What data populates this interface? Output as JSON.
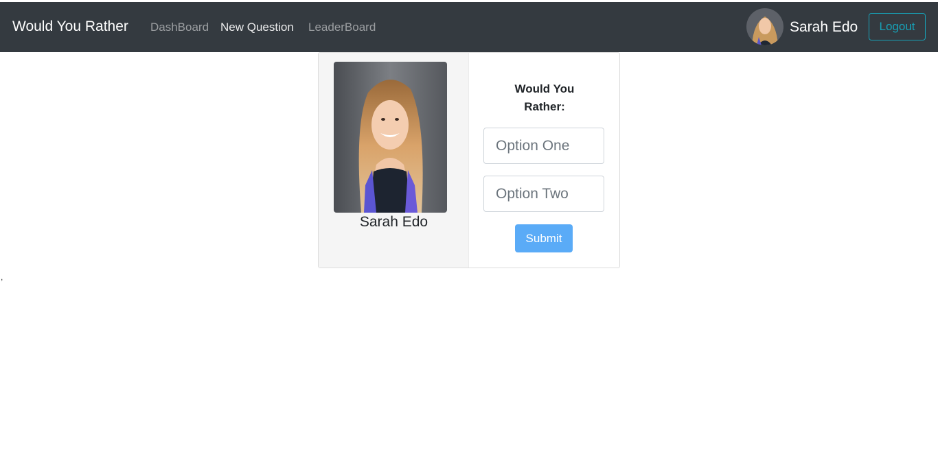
{
  "navbar": {
    "brand": "Would You Rather",
    "links": [
      {
        "label": "DashBoard",
        "active": false
      },
      {
        "label": "New Question",
        "active": true
      },
      {
        "label": "LeaderBoard",
        "active": false
      }
    ],
    "user_name": "Sarah Edo",
    "logout_label": "Logout"
  },
  "card": {
    "author_name": "Sarah Edo",
    "title": "Would You Rather:",
    "option_one_placeholder": "Option One",
    "option_two_placeholder": "Option Two",
    "submit_label": "Submit"
  },
  "stray_text": ",",
  "colors": {
    "navbar_bg": "#343a40",
    "logout_outline": "#17a2b8",
    "submit_bg": "#5aabf7"
  },
  "icons": {
    "nav_avatar": "user-avatar-photo",
    "card_photo": "author-portrait-photo"
  }
}
